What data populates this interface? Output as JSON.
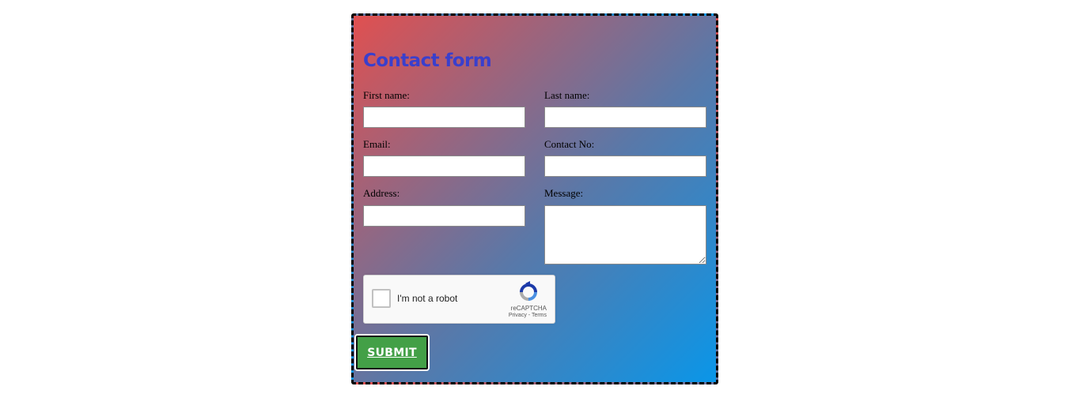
{
  "form": {
    "title": "Contact form",
    "first_name_label": "First name:",
    "last_name_label": "Last name:",
    "email_label": "Email:",
    "contact_label": "Contact No:",
    "address_label": "Address:",
    "message_label": "Message:",
    "first_name_value": "",
    "last_name_value": "",
    "email_value": "",
    "contact_value": "",
    "address_value": "",
    "message_value": ""
  },
  "captcha": {
    "label": "I'm not a robot",
    "brand": "reCAPTCHA",
    "privacy": "Privacy",
    "separator": " - ",
    "terms": "Terms",
    "checked": false
  },
  "submit": {
    "label": "SUBMIT"
  },
  "colors": {
    "title": "#3a3fcc",
    "submit_bg": "#43a047",
    "gradient_start": "#e05050",
    "gradient_end": "#0a96e8"
  }
}
